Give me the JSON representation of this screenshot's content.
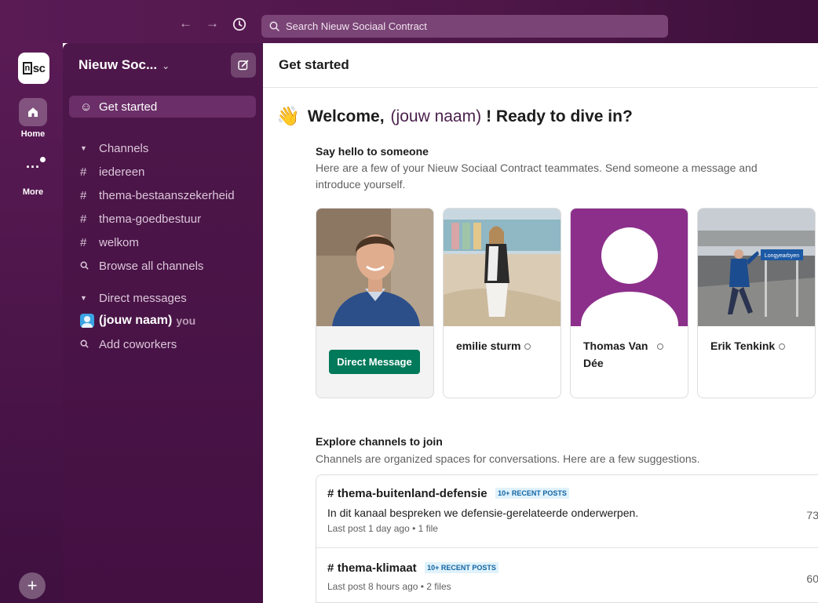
{
  "colors": {
    "aubergine": "#4e174b",
    "accent_green": "#007a5a",
    "badge_blue": "#1264a3"
  },
  "topbar": {
    "back_icon": "arrow-left-icon",
    "forward_icon": "arrow-right-icon",
    "history_icon": "clock-icon",
    "search_placeholder": "Search Nieuw Sociaal Contract"
  },
  "rail": {
    "logo_box": "n",
    "logo_text": "sc",
    "home_label": "Home",
    "more_label": "More",
    "more_glyph": "···",
    "add_glyph": "+"
  },
  "sidebar": {
    "workspace_name": "Nieuw Soc...",
    "workspace_chevron": "⌄",
    "get_started": "Get started",
    "channels_header": "Channels",
    "channels": [
      "iedereen",
      "thema-bestaanszekerheid",
      "thema-goedbestuur",
      "welkom"
    ],
    "hash": "#",
    "browse_channels": "Browse all channels",
    "dm_header": "Direct messages",
    "me_name": "(jouw naam)",
    "me_suffix": "you",
    "add_coworkers": "Add coworkers"
  },
  "main": {
    "title": "Get started",
    "welcome_prefix": "Welcome,",
    "welcome_name": "(jouw naam)",
    "welcome_suffix": "! Ready to dive in?",
    "wave_emoji": "👋",
    "hello_title": "Say hello to someone",
    "hello_desc_1": "Here are a few of your Nieuw Sociaal Contract teammates. Send someone a message and",
    "hello_desc_2": "introduce yourself.",
    "teammates": [
      {
        "name": "",
        "button": "Direct Message"
      },
      {
        "name": "emilie sturm"
      },
      {
        "name_line1": "Thomas Van",
        "name_line2": "Dée"
      },
      {
        "name": "Erik Tenkink",
        "sign": "Longyearbyen"
      }
    ],
    "explore_title": "Explore channels to join",
    "explore_desc": "Channels are organized spaces for conversations. Here are a few suggestions.",
    "channels": [
      {
        "name": "thema-buitenland-defensie",
        "badge": "10+ RECENT POSTS",
        "description": "In dit kanaal bespreken we defensie-gerelateerde onderwerpen.",
        "meta": "Last post 1 day ago • 1 file",
        "count": "73"
      },
      {
        "name": "thema-klimaat",
        "badge": "10+ RECENT POSTS",
        "meta": "Last post 8 hours ago • 2 files",
        "count": "60"
      }
    ]
  }
}
